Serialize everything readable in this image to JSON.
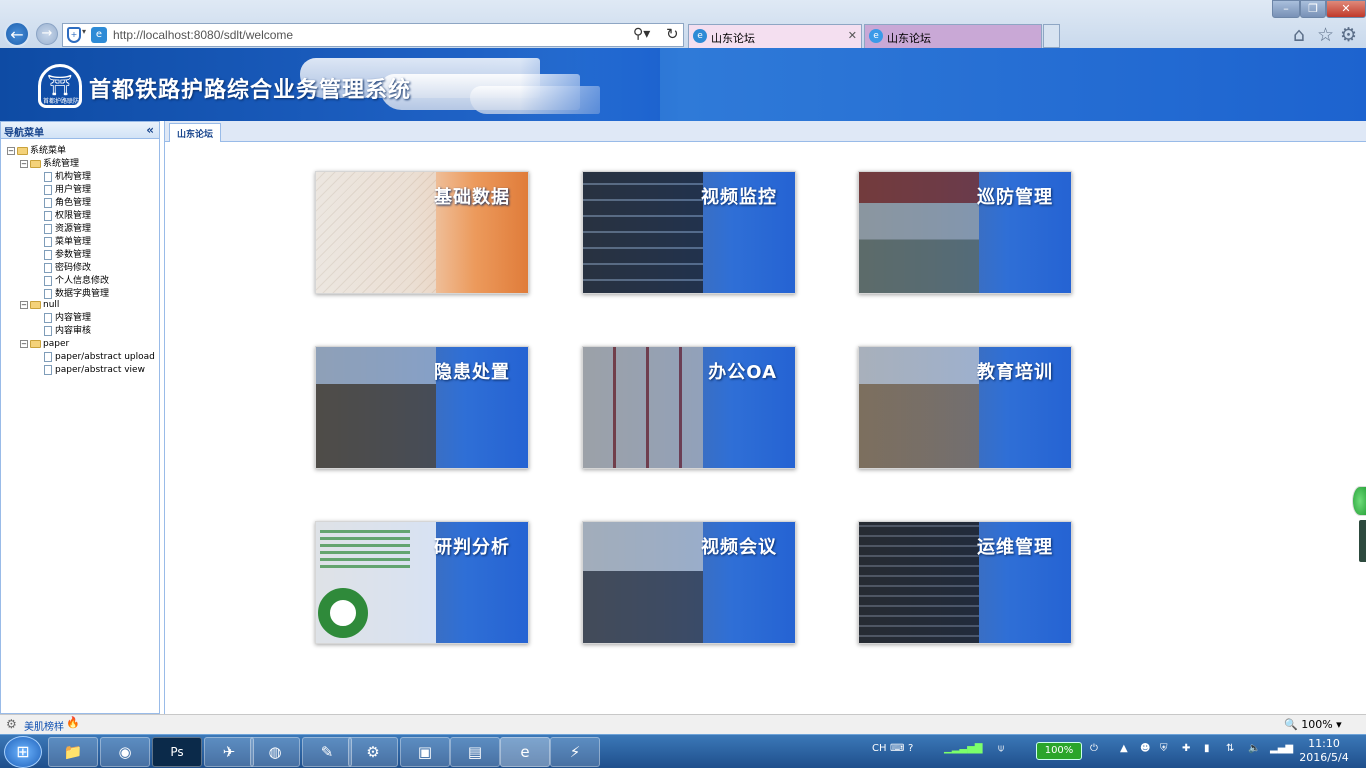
{
  "browser": {
    "url": "http://localhost:8080/sdlt/welcome",
    "tabs": [
      {
        "label": "山东论坛"
      },
      {
        "label": "山东论坛"
      }
    ]
  },
  "app": {
    "title": "首都铁路护路综合业务管理系统",
    "logo_caption": "首都护路联防"
  },
  "sidebar": {
    "header": "导航菜单",
    "tree": {
      "root": "系统菜单",
      "groups": [
        {
          "label": "系统管理",
          "items": [
            "机构管理",
            "用户管理",
            "角色管理",
            "权限管理",
            "资源管理",
            "菜单管理",
            "参数管理",
            "密码修改",
            "个人信息修改",
            "数据字典管理"
          ]
        },
        {
          "label": "null",
          "items": [
            "内容管理",
            "内容审核"
          ]
        },
        {
          "label": "paper",
          "items": [
            "paper/abstract upload",
            "paper/abstract view"
          ]
        }
      ]
    }
  },
  "main": {
    "tab_label": "山东论坛",
    "tiles": [
      "基础数据",
      "视频监控",
      "巡防管理",
      "隐患处置",
      "办公OA",
      "教育培训",
      "研判分析",
      "视频会议",
      "运维管理"
    ]
  },
  "statusbar": {
    "link": "美肌榜样",
    "zoom": "100%"
  },
  "taskbar": {
    "battery": "100%",
    "input_lang": "CH",
    "time": "11:10",
    "date": "2016/5/4"
  },
  "colors": {
    "banner": "#1f62c6",
    "tile_blue": "#2563d3",
    "tree_header": "#15428b"
  }
}
